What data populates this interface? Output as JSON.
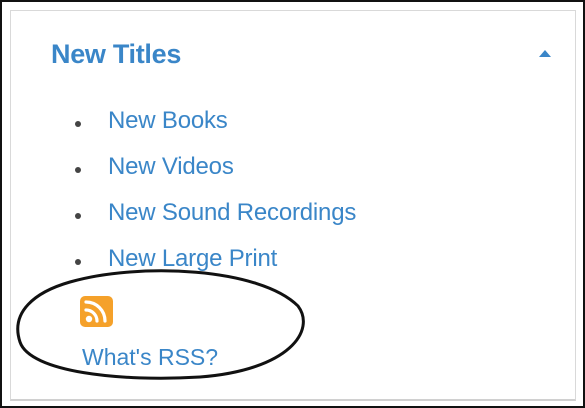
{
  "colors": {
    "accent": "#3a86c8",
    "link": "#3a86c8",
    "rss": "#f5a12a",
    "annotation": "#111111"
  },
  "panel": {
    "title": "New Titles",
    "collapse_icon": "caret-up-icon",
    "items": [
      {
        "label": "New Books"
      },
      {
        "label": "New Videos"
      },
      {
        "label": "New Sound Recordings"
      },
      {
        "label": "New Large Print"
      }
    ],
    "rss_icon": "rss-feed-icon",
    "rss_link_label": "What's RSS?"
  }
}
